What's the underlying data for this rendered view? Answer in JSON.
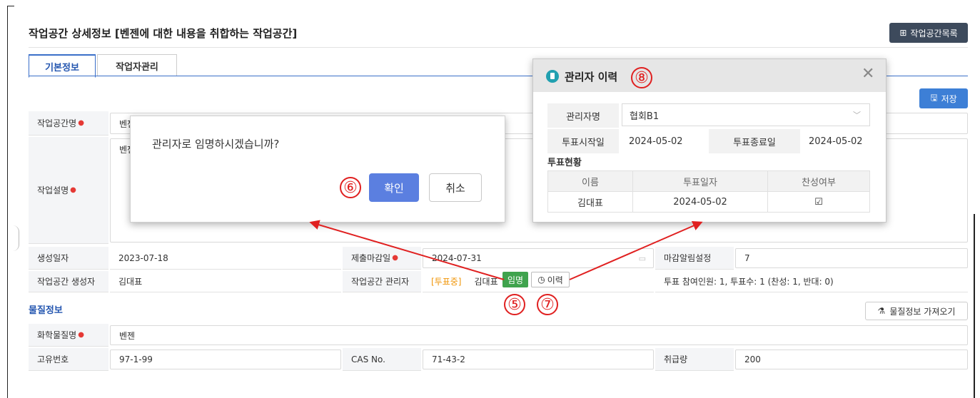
{
  "page": {
    "title": "작업공간 상세정보",
    "subtitle": "[벤젠에 대한 내용을 취합하는 작업공간]",
    "list_button": "작업공간목록",
    "save_button": "저장"
  },
  "tabs": [
    {
      "label": "기본정보",
      "active": true
    },
    {
      "label": "작업자관리",
      "active": false
    }
  ],
  "form": {
    "workspace_name_label": "작업공간명",
    "workspace_name_value": "벤젠",
    "workspace_desc_label": "작업설명",
    "workspace_desc_value": "벤젠",
    "created_label": "생성일자",
    "created_value": "2023-07-18",
    "deadline_label": "제출마감일",
    "deadline_value": "2024-07-31",
    "deadline_alert_label": "마감알림설정",
    "deadline_alert_value": "7",
    "creator_label": "작업공간 생성자",
    "creator_value": "김대표",
    "manager_label": "작업공간 관리자",
    "manager_status": "[투표중]",
    "manager_name": "김대표",
    "appoint_button": "임명",
    "history_button": "이력",
    "vote_summary": "투표 참여인원: 1, 투표수: 1 (찬성: 1, 반대: 0)"
  },
  "material": {
    "section_title": "물질정보",
    "fetch_button": "물질정보 가져오기",
    "chem_name_label": "화학물질명",
    "chem_name_value": "벤젠",
    "unique_no_label": "고유번호",
    "unique_no_value": "97-1-99",
    "cas_label": "CAS No.",
    "cas_value": "71-43-2",
    "amount_label": "취급량",
    "amount_value": "200"
  },
  "confirm_dialog": {
    "message": "관리자로 임명하시겠습니까?",
    "ok": "확인",
    "cancel": "취소"
  },
  "history_dialog": {
    "title": "관리자 이력",
    "manager_label": "관리자명",
    "manager_value": "협회B1",
    "vote_start_label": "투표시작일",
    "vote_start_value": "2024-05-02",
    "vote_end_label": "투표종료일",
    "vote_end_value": "2024-05-02",
    "status_title": "투표현황",
    "table_headers": [
      "이름",
      "투표일자",
      "찬성여부"
    ],
    "table_rows": [
      {
        "name": "김대표",
        "date": "2024-05-02",
        "agree": "☑"
      }
    ]
  },
  "annotations": {
    "n5": "⑤",
    "n6": "⑥",
    "n7": "⑦",
    "n8": "⑧"
  },
  "colors": {
    "accent": "#3d7fd6",
    "tab_blue": "#2456b0",
    "required": "#e53935",
    "status_orange": "#f0960a",
    "appoint_green": "#3fa34d",
    "annotation_red": "#e02020"
  }
}
